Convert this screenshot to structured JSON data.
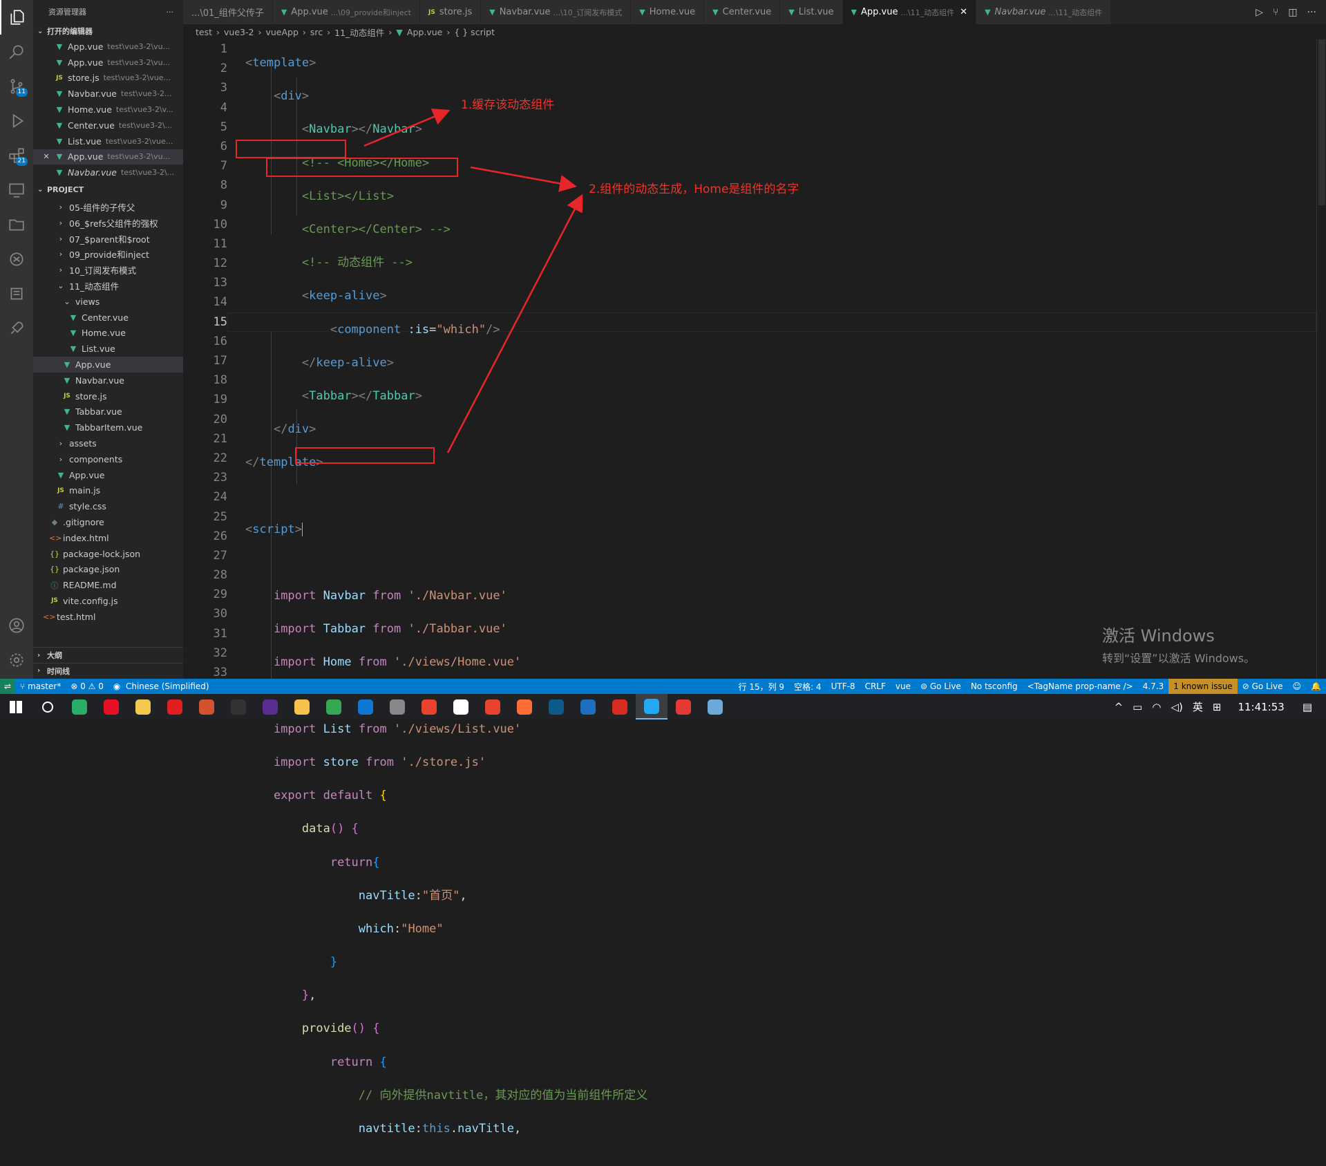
{
  "sidebar": {
    "title": "资源管理器",
    "more": "···",
    "open_editors_label": "打开的编辑器",
    "open_editors": [
      {
        "name": "App.vue",
        "desc": "test\\vue3-2\\vu...",
        "icon": "vue-icon",
        "close": ""
      },
      {
        "name": "App.vue",
        "desc": "test\\vue3-2\\vu...",
        "icon": "vue-icon",
        "close": ""
      },
      {
        "name": "store.js",
        "desc": "test\\vue3-2\\vue...",
        "icon": "js-icon",
        "close": ""
      },
      {
        "name": "Navbar.vue",
        "desc": "test\\vue3-2...",
        "icon": "vue-icon",
        "close": ""
      },
      {
        "name": "Home.vue",
        "desc": "test\\vue3-2\\v...",
        "icon": "vue-icon",
        "close": ""
      },
      {
        "name": "Center.vue",
        "desc": "test\\vue3-2\\...",
        "icon": "vue-icon",
        "close": ""
      },
      {
        "name": "List.vue",
        "desc": "test\\vue3-2\\vue...",
        "icon": "vue-icon",
        "close": ""
      },
      {
        "name": "App.vue",
        "desc": "test\\vue3-2\\vu...",
        "icon": "vue-icon",
        "close": "✕"
      },
      {
        "name": "Navbar.vue",
        "desc": "test\\vue3-2\\...",
        "icon": "vue-icon",
        "close": ""
      }
    ],
    "project_label": "PROJECT",
    "tree": [
      {
        "name": "05-组件的子传父",
        "indent": 1,
        "type": "folder",
        "chev": "›"
      },
      {
        "name": "06_$refs父组件的强权",
        "indent": 1,
        "type": "folder",
        "chev": "›"
      },
      {
        "name": "07_$parent和$root",
        "indent": 1,
        "type": "folder",
        "chev": "›"
      },
      {
        "name": "09_provide和inject",
        "indent": 1,
        "type": "folder",
        "chev": "›"
      },
      {
        "name": "10_订阅发布模式",
        "indent": 1,
        "type": "folder",
        "chev": "›"
      },
      {
        "name": "11_动态组件",
        "indent": 1,
        "type": "folder",
        "chev": "⌄"
      },
      {
        "name": "views",
        "indent": 2,
        "type": "folder",
        "chev": "⌄"
      },
      {
        "name": "Center.vue",
        "indent": 3,
        "type": "vue",
        "chev": ""
      },
      {
        "name": "Home.vue",
        "indent": 3,
        "type": "vue",
        "chev": ""
      },
      {
        "name": "List.vue",
        "indent": 3,
        "type": "vue",
        "chev": ""
      },
      {
        "name": "App.vue",
        "indent": 2,
        "type": "vue",
        "chev": "",
        "selected": true
      },
      {
        "name": "Navbar.vue",
        "indent": 2,
        "type": "vue",
        "chev": ""
      },
      {
        "name": "store.js",
        "indent": 2,
        "type": "js",
        "chev": ""
      },
      {
        "name": "Tabbar.vue",
        "indent": 2,
        "type": "vue",
        "chev": ""
      },
      {
        "name": "TabbarItem.vue",
        "indent": 2,
        "type": "vue",
        "chev": ""
      },
      {
        "name": "assets",
        "indent": 1,
        "type": "folder",
        "chev": "›"
      },
      {
        "name": "components",
        "indent": 1,
        "type": "folder",
        "chev": "›"
      },
      {
        "name": "App.vue",
        "indent": 1,
        "type": "vue",
        "chev": ""
      },
      {
        "name": "main.js",
        "indent": 1,
        "type": "js",
        "chev": ""
      },
      {
        "name": "style.css",
        "indent": 1,
        "type": "css",
        "chev": ""
      },
      {
        "name": ".gitignore",
        "indent": 0,
        "type": "git",
        "chev": ""
      },
      {
        "name": "index.html",
        "indent": 0,
        "type": "html",
        "chev": ""
      },
      {
        "name": "package-lock.json",
        "indent": 0,
        "type": "json",
        "chev": ""
      },
      {
        "name": "package.json",
        "indent": 0,
        "type": "json",
        "chev": ""
      },
      {
        "name": "README.md",
        "indent": 0,
        "type": "info",
        "chev": ""
      },
      {
        "name": "vite.config.js",
        "indent": 0,
        "type": "js",
        "chev": ""
      },
      {
        "name": "test.html",
        "indent": -1,
        "type": "html",
        "chev": ""
      }
    ],
    "outline_label": "大纲",
    "timeline_label": "时间线"
  },
  "tabs": [
    {
      "name": "...\\01_组件父传子",
      "path": "",
      "icon": "",
      "active": false
    },
    {
      "name": "App.vue",
      "path": "...\\09_provide和inject",
      "icon": "vue-icon",
      "active": false
    },
    {
      "name": "store.js",
      "path": "",
      "icon": "js-icon",
      "active": false
    },
    {
      "name": "Navbar.vue",
      "path": "...\\10_订阅发布模式",
      "icon": "vue-icon",
      "active": false
    },
    {
      "name": "Home.vue",
      "path": "",
      "icon": "vue-icon",
      "active": false
    },
    {
      "name": "Center.vue",
      "path": "",
      "icon": "vue-icon",
      "active": false
    },
    {
      "name": "List.vue",
      "path": "",
      "icon": "vue-icon",
      "active": false
    },
    {
      "name": "App.vue",
      "path": "...\\11_动态组件",
      "icon": "vue-icon",
      "active": true,
      "close": "✕"
    },
    {
      "name": "Navbar.vue",
      "path": "...\\11_动态组件",
      "icon": "vue-icon",
      "active": false
    }
  ],
  "breadcrumb": [
    "test",
    "vue3-2",
    "vueApp",
    "src",
    "11_动态组件",
    "App.vue",
    "{ } script"
  ],
  "editor": {
    "current_line": 15,
    "line_numbers": [
      "1",
      "2",
      "3",
      "4",
      "5",
      "6",
      "7",
      "8",
      "9",
      "10",
      "11",
      "12",
      "13",
      "14",
      "15",
      "16",
      "17",
      "18",
      "19",
      "20",
      "21",
      "22",
      "23",
      "24",
      "25",
      "26",
      "27",
      "28",
      "29",
      "30",
      "31",
      "32",
      "33"
    ]
  },
  "annotations": {
    "note1": "1.缓存该动态组件",
    "note2": "2.组件的动态生成，Home是组件的名字"
  },
  "watermark": {
    "line1": "激活 Windows",
    "line2": "转到“设置”以激活 Windows。"
  },
  "status": {
    "branch": "master*",
    "problems": "⊗ 0 ⚠ 0",
    "lang_pack": "Chinese (Simplified)",
    "position": "行 15，列 9",
    "spaces": "空格: 4",
    "encoding": "UTF-8",
    "eol": "CRLF",
    "language": "vue",
    "golive1": "Go Live",
    "tsconfig": "No tsconfig",
    "tagname": "<TagName prop-name />",
    "version": "4.7.3",
    "issue": "1 known issue",
    "golive2": "Go Live"
  },
  "taskbar": {
    "apps": [
      "windows-start",
      "search",
      "wechat",
      "opera",
      "explorer",
      "youdao",
      "powerpoint",
      "terminal",
      "vs",
      "paw",
      "chrome",
      "edge",
      "unity",
      "wps",
      "typora",
      "record",
      "postman",
      "teamviewer",
      "virtualbox",
      "redis",
      "vscode",
      "jetbrains",
      "other"
    ],
    "active_app": "vscode",
    "ime": "英",
    "time": "11:41:53"
  },
  "colors": {
    "accent": "#007acc",
    "annotation": "#e8262a",
    "vue": "#41b883"
  }
}
